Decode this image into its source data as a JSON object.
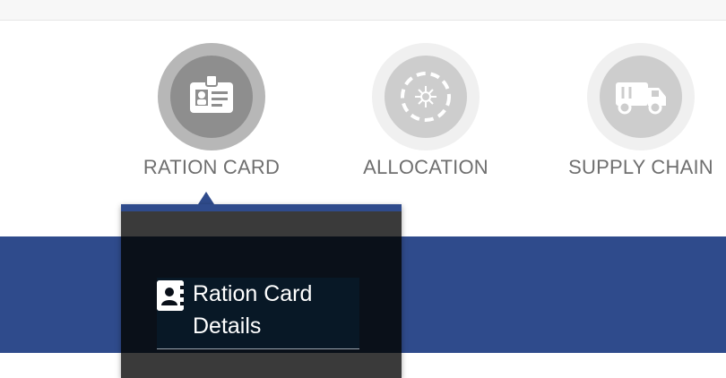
{
  "nav": {
    "items": [
      {
        "label": "RATION CARD",
        "icon": "id-card-icon",
        "active": true
      },
      {
        "label": "ALLOCATION",
        "icon": "wheel-icon",
        "active": false
      },
      {
        "label": "SUPPLY CHAIN",
        "icon": "truck-icon",
        "active": false
      }
    ]
  },
  "dropdown": {
    "items": [
      {
        "label": "Ration Card Details",
        "icon": "address-book-icon"
      }
    ]
  },
  "colors": {
    "band": "#2f4b8c",
    "dropdown": "#3a3a3a",
    "nav_label": "#6f6f6f"
  }
}
